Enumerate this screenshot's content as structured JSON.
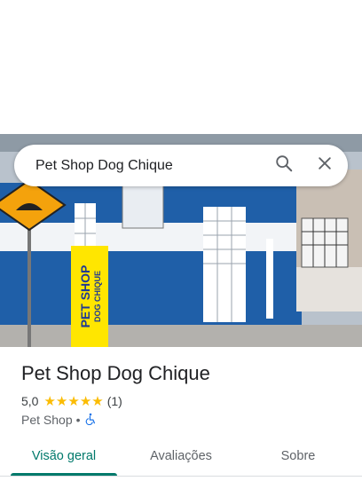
{
  "search": {
    "query": "Pet Shop Dog Chique",
    "search_icon": "search-icon",
    "close_icon": "close-icon"
  },
  "photo": {
    "banner_line1": "PET SHOP",
    "banner_line2": "DOG CHIQUE"
  },
  "place": {
    "name": "Pet Shop Dog Chique",
    "rating": "5,0",
    "stars": 5,
    "review_count": "(1)",
    "category": "Pet Shop",
    "separator": "•",
    "accessibility_icon": "wheelchair-accessible-icon"
  },
  "tabs": [
    {
      "label": "Visão geral",
      "active": true
    },
    {
      "label": "Avaliações",
      "active": false
    },
    {
      "label": "Sobre",
      "active": false
    }
  ],
  "colors": {
    "accent": "#00796b",
    "star": "#fbbc04",
    "accessibility": "#1a73e8"
  }
}
